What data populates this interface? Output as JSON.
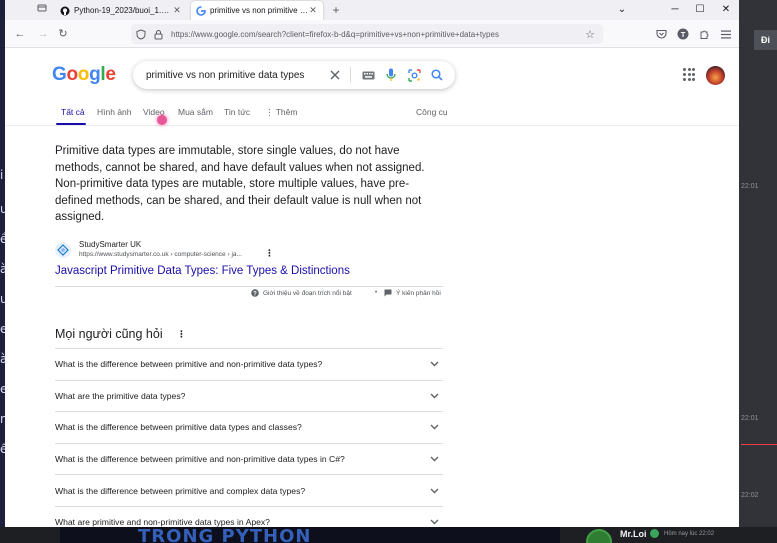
{
  "background": {
    "left_chars": [
      "i",
      "ư",
      "ề",
      "à",
      "ư",
      "e",
      "à",
      "e",
      "n",
      "ế"
    ],
    "right_badge": "Đi",
    "timestamps": [
      "22:01",
      "22:01",
      "22:02"
    ],
    "video_overlay": "TRONG PYTHON",
    "chat_user": "Mr.Loi",
    "chat_time": "Hôm nay lúc 22:02"
  },
  "browser": {
    "tabs": [
      {
        "title": "Python-19_2023/buoi_1.py at m",
        "active": false
      },
      {
        "title": "primitive vs non primitive data ty",
        "active": true
      }
    ],
    "url": "https://www.google.com/search?client=firefox-b-d&q=primitive+vs+non+primitive+data+types"
  },
  "google": {
    "logo_letters": [
      "G",
      "o",
      "o",
      "g",
      "l",
      "e"
    ],
    "logo_colors": [
      "#4285F4",
      "#EA4335",
      "#FBBC05",
      "#4285F4",
      "#34A853",
      "#EA4335"
    ],
    "query": "primitive vs non primitive data types",
    "tabs": [
      "Tất cả",
      "Hình ảnh",
      "Video",
      "Mua sắm",
      "Tin tức",
      "Thêm"
    ],
    "tools": "Công cụ",
    "snippet": "Primitive data types are immutable, store single values, do not have methods, cannot be shared, and have default values when not assigned. Non-primitive data types are mutable, store multiple values, have pre-defined methods, can be shared, and their default value is null when not assigned.",
    "source": {
      "name": "StudySmarter UK",
      "url": "https://www.studysmarter.co.uk › computer-science › ja..."
    },
    "result_title": "Javascript Primitive Data Types: Five Types & Distinctions",
    "feedback": {
      "about": "Giới thiệu về đoạn trích nổi bật",
      "feedback": "Ý kiến phản hồi"
    },
    "paa_title": "Mọi người cũng hỏi",
    "questions": [
      "What is the difference between primitive and non-primitive data types?",
      "What are the primitive data types?",
      "What is the difference between primitive data types and classes?",
      "What is the difference between primitive and non-primitive data types in C#?",
      "What is the difference between primitive and complex data types?",
      "What are primitive and non-primitive data types in Apex?"
    ]
  }
}
